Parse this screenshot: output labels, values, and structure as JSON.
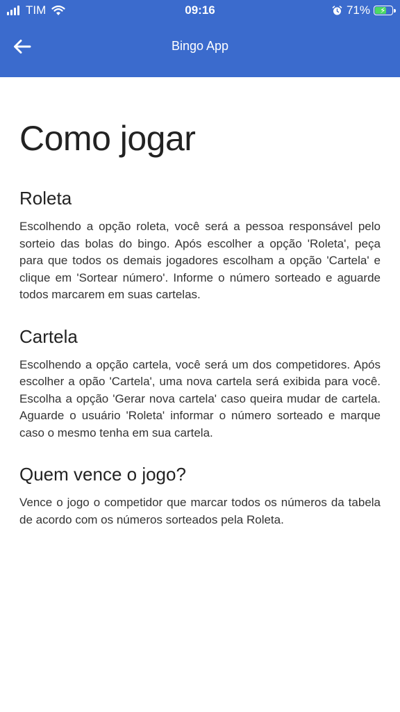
{
  "status_bar": {
    "carrier": "TIM",
    "time": "09:16",
    "battery": "71%",
    "battery_level": 0.71,
    "icons": [
      "signal-icon",
      "wifi-icon",
      "alarm-icon",
      "battery-charging-icon"
    ]
  },
  "app_bar": {
    "back_icon": "arrow-left-icon",
    "title": "Bingo App",
    "color": "#3b6bcd"
  },
  "content": {
    "title": "Como jogar",
    "sections": [
      {
        "heading": "Roleta",
        "text": "Escolhendo a opção roleta, você será a pessoa responsável pelo sorteio das bolas do bingo. Após escolher a opção 'Roleta', peça para que todos os demais jogadores escolham a opção 'Cartela' e clique em 'Sortear número'. Informe o número sorteado e aguarde todos marcarem em suas cartelas."
      },
      {
        "heading": "Cartela",
        "text": "Escolhendo a opção cartela, você será um dos competidores. Após escolher a opão 'Cartela', uma nova cartela será exibida para você. Escolha a opção 'Gerar nova cartela' caso queira mudar de cartela. Aguarde o usuário 'Roleta' informar o número sorteado e marque caso o mesmo tenha em sua cartela."
      },
      {
        "heading": "Quem vence o jogo?",
        "text": "Vence o jogo o competidor que marcar todos os números da tabela de acordo com os números sorteados pela Roleta."
      }
    ]
  }
}
